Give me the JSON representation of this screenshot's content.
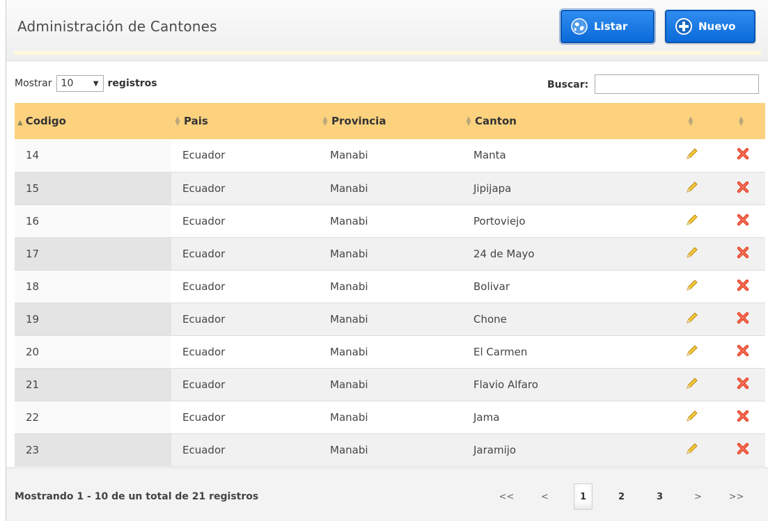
{
  "header": {
    "title": "Administración de Cantones",
    "listar_label": "Listar",
    "nuevo_label": "Nuevo"
  },
  "controls": {
    "mostrar_label": "Mostrar",
    "page_size_value": "10",
    "registros_label": "registros",
    "buscar_label": "Buscar:",
    "search_value": ""
  },
  "table": {
    "headers": [
      "Codigo",
      "Pais",
      "Provincia",
      "Canton",
      "",
      ""
    ],
    "rows": [
      {
        "codigo": "14",
        "pais": "Ecuador",
        "provincia": "Manabi",
        "canton": "Manta"
      },
      {
        "codigo": "15",
        "pais": "Ecuador",
        "provincia": "Manabi",
        "canton": "Jipijapa"
      },
      {
        "codigo": "16",
        "pais": "Ecuador",
        "provincia": "Manabi",
        "canton": "Portoviejo"
      },
      {
        "codigo": "17",
        "pais": "Ecuador",
        "provincia": "Manabi",
        "canton": "24 de Mayo"
      },
      {
        "codigo": "18",
        "pais": "Ecuador",
        "provincia": "Manabi",
        "canton": "Bolivar"
      },
      {
        "codigo": "19",
        "pais": "Ecuador",
        "provincia": "Manabi",
        "canton": "Chone"
      },
      {
        "codigo": "20",
        "pais": "Ecuador",
        "provincia": "Manabi",
        "canton": "El Carmen"
      },
      {
        "codigo": "21",
        "pais": "Ecuador",
        "provincia": "Manabi",
        "canton": "Flavio Alfaro"
      },
      {
        "codigo": "22",
        "pais": "Ecuador",
        "provincia": "Manabi",
        "canton": "Jama"
      },
      {
        "codigo": "23",
        "pais": "Ecuador",
        "provincia": "Manabi",
        "canton": "Jaramijo"
      }
    ],
    "row_actions": [
      "pencil-edit-icon",
      "red-x-delete-icon"
    ]
  },
  "footer": {
    "info": "Mostrando 1 - 10 de un total de 21 registros",
    "pager": {
      "first": "<<",
      "prev": "<",
      "pages": [
        "1",
        "2",
        "3"
      ],
      "next": ">",
      "last": ">>",
      "current_page": "1"
    }
  },
  "colors": {
    "header_row": "#fcd27f",
    "button_blue": "#0a6ad8",
    "delete_red": "#e8452c",
    "edit_yellow": "#f2c233"
  }
}
